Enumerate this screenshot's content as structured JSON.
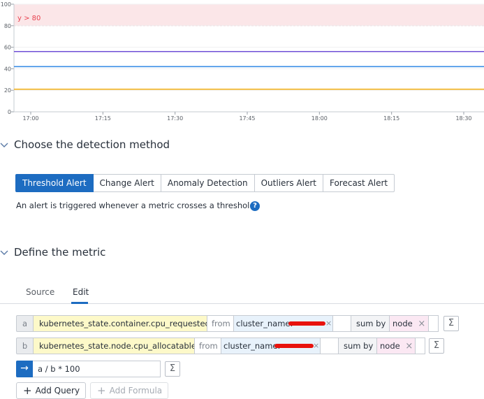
{
  "chart_data": {
    "type": "line",
    "y_ticks": [
      "0",
      "20",
      "40",
      "60",
      "80",
      "100"
    ],
    "ylim": [
      0,
      100
    ],
    "x_ticks": [
      "17:00",
      "17:15",
      "17:30",
      "17:45",
      "18:00",
      "18:15",
      "18:30"
    ],
    "threshold": {
      "label": "y > 80",
      "value": 80,
      "color": "#fbe6e8",
      "line_color": "#f0a2aa",
      "text_color": "#e8424f"
    },
    "series": [
      {
        "values": [
          56,
          56
        ],
        "color": "#6f4fd6"
      },
      {
        "values": [
          42,
          42
        ],
        "color": "#3a8ee6"
      },
      {
        "values": [
          21,
          21
        ],
        "color": "#f2b11c"
      }
    ]
  },
  "detection": {
    "title": "Choose the detection method",
    "tabs": [
      "Threshold Alert",
      "Change Alert",
      "Anomaly Detection",
      "Outliers Alert",
      "Forecast Alert"
    ],
    "active_tab": "Threshold Alert",
    "description": "An alert is triggered whenever a metric crosses a threshold.",
    "help_icon": "question-icon"
  },
  "metric": {
    "title": "Define the metric",
    "tabs": [
      "Source",
      "Edit"
    ],
    "active_tab": "Edit",
    "queries": [
      {
        "letter": "a",
        "metric": "kubernetes_state.container.cpu_requested",
        "from": "from",
        "filter": "cluster_name:",
        "agg": "sum by",
        "group": "node"
      },
      {
        "letter": "b",
        "metric": "kubernetes_state.node.cpu_allocatable",
        "from": "from",
        "filter": "cluster_name:",
        "agg": "sum by",
        "group": "node"
      }
    ],
    "formula": "a / b * 100",
    "sigma": "Σ",
    "close": "×",
    "arrow": "→",
    "add_query": "Add Query",
    "add_formula": "Add Formula"
  }
}
